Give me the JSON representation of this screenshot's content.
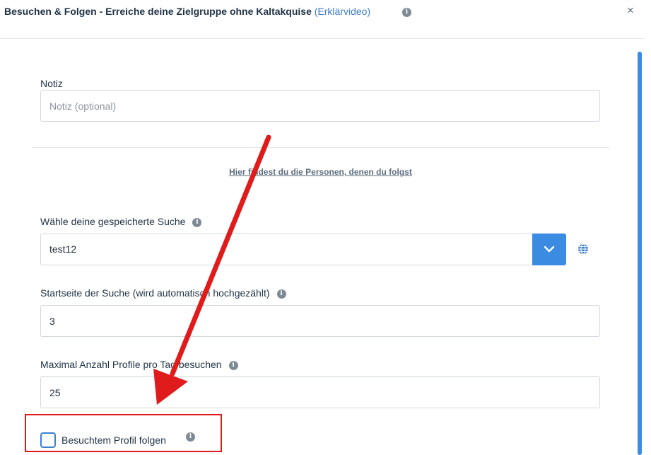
{
  "dialog": {
    "title": "Besuchen & Folgen - Erreiche deine Zielgruppe ohne Kaltakquise",
    "video_link": "(Erklärvideo)",
    "close_symbol": "×"
  },
  "note": {
    "label": "Notiz",
    "placeholder": "Notiz (optional)",
    "value": ""
  },
  "follow_link": "Hier findest du die Personen, denen du folgst",
  "saved_search": {
    "label": "Wähle deine gespeicherte Suche",
    "selected": "test12"
  },
  "start_page": {
    "label": "Startseite der Suche (wird automatisch hochgezählt)",
    "value": "3"
  },
  "max_profiles": {
    "label": "Maximal Anzahl Profile pro Tag besuchen",
    "value": "25"
  },
  "follow_checkbox": {
    "label": "Besuchtem Profil folgen",
    "checked": false
  },
  "icons": {
    "info": "info-icon",
    "close": "close-icon",
    "chevron": "chevron-down-icon",
    "globe": "globe-icon"
  },
  "colors": {
    "accent": "#3b8be3",
    "annotation": "#e01b1b",
    "title": "#1f3346",
    "link": "#3d7ec9"
  }
}
